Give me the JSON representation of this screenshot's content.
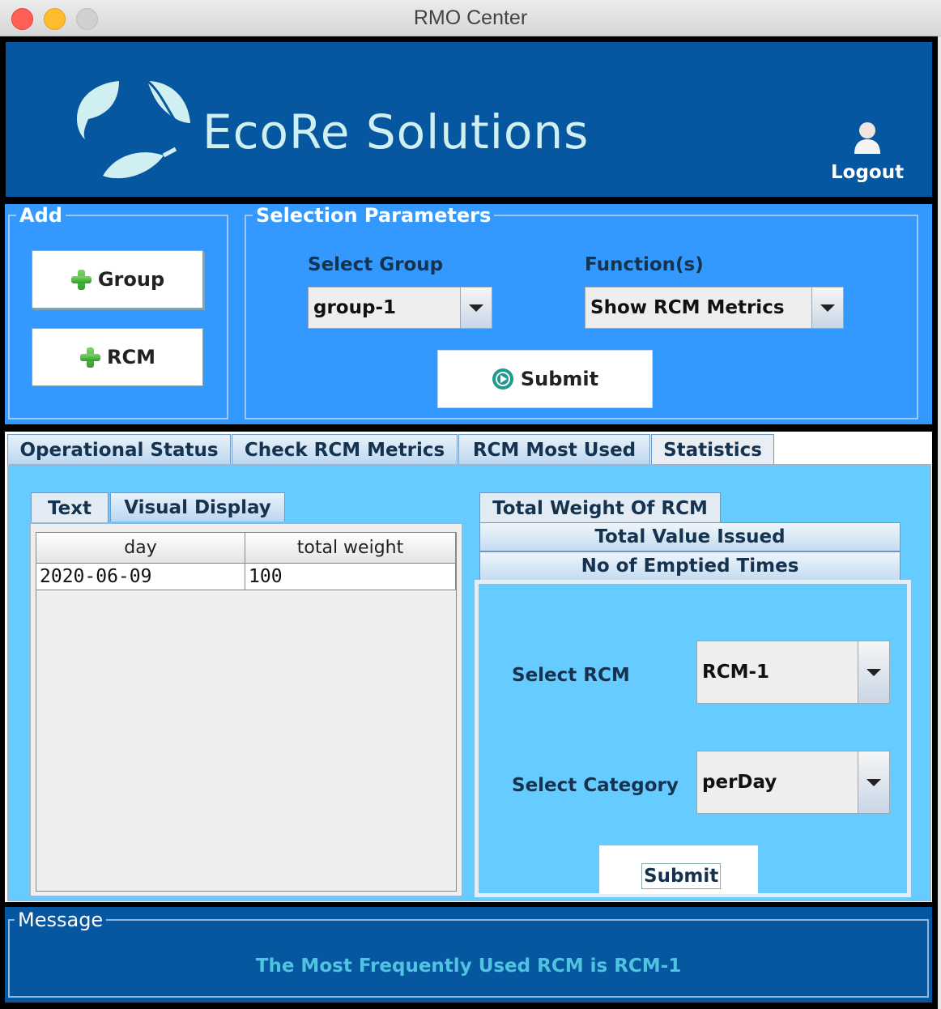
{
  "window": {
    "title": "RMO Center"
  },
  "header": {
    "brand": "EcoRe Solutions",
    "logout_label": "Logout"
  },
  "add_panel": {
    "legend": "Add",
    "group_button": "Group",
    "rcm_button": "RCM"
  },
  "selection": {
    "legend": "Selection Parameters",
    "group_label": "Select Group",
    "group_value": "group-1",
    "function_label": "Function(s)",
    "function_value": "Show RCM Metrics",
    "submit_label": "Submit"
  },
  "tabs": [
    {
      "label": "Operational Status"
    },
    {
      "label": "Check RCM Metrics"
    },
    {
      "label": "RCM Most Used"
    },
    {
      "label": "Statistics"
    }
  ],
  "subtabs": [
    {
      "label": "Text"
    },
    {
      "label": "Visual Display"
    }
  ],
  "table": {
    "columns": [
      "day",
      "total weight"
    ],
    "rows": [
      [
        "2020-06-09",
        "100"
      ]
    ]
  },
  "stat_tabs": [
    {
      "label": "Total Weight Of RCM"
    },
    {
      "label": "Total Value Issued"
    },
    {
      "label": "No of Emptied Times"
    }
  ],
  "stat_form": {
    "rcm_label": "Select RCM",
    "rcm_value": "RCM-1",
    "category_label": "Select Category",
    "category_value": "perDay",
    "submit_label": "Submit"
  },
  "message": {
    "legend": "Message",
    "text": "The Most Frequently Used RCM is RCM-1"
  },
  "colors": {
    "header_bg": "#0656a0",
    "panel_bg": "#3399ff",
    "content_bg": "#66ccff",
    "brand_text": "#cfeff0",
    "message_text": "#4fc3e0"
  }
}
